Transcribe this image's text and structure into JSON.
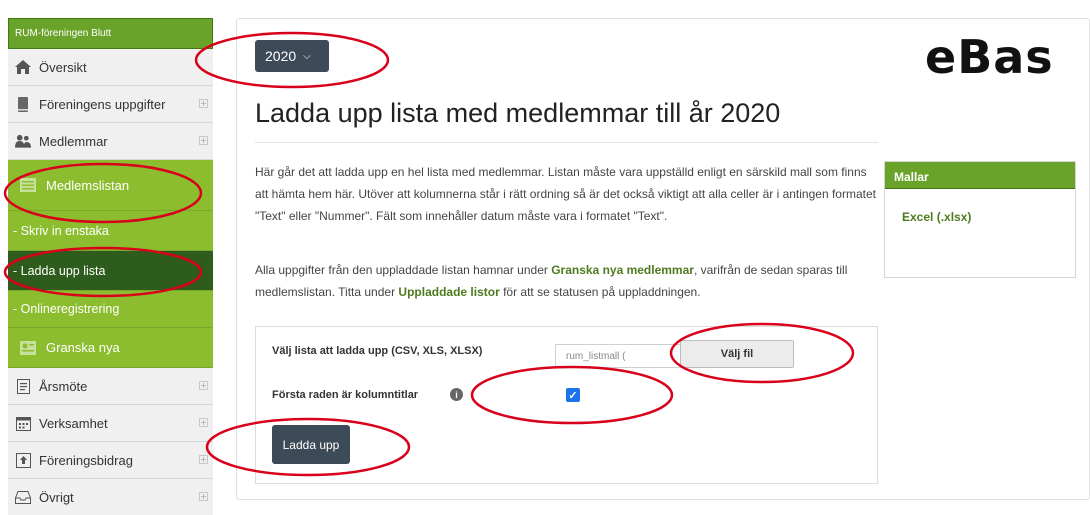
{
  "sidebar": {
    "org_name": "RUM-föreningen Blutt",
    "items": [
      {
        "label": "Översikt"
      },
      {
        "label": "Föreningens uppgifter"
      },
      {
        "label": "Medlemmar"
      },
      {
        "label": "Medlemslistan"
      },
      {
        "label": "- Skriv in enstaka"
      },
      {
        "label": "- Ladda upp lista"
      },
      {
        "label": "- Onlineregistrering"
      },
      {
        "label": "Granska nya"
      },
      {
        "label": "Årsmöte"
      },
      {
        "label": "Verksamhet"
      },
      {
        "label": "Föreningsbidrag"
      },
      {
        "label": "Övrigt"
      }
    ]
  },
  "header": {
    "year": "2020",
    "logo": "eBas",
    "title": "Ladda upp lista med medlemmar till år 2020"
  },
  "intro": {
    "p1": "Här går det att ladda upp en hel lista med medlemmar. Listan måste vara uppställd enligt en särskild mall som finns att hämta hem här. Utöver att kolumnerna står i rätt ordning så är det också viktigt att alla celler är i antingen formatet \"Text\" eller \"Nummer\". Fält som innehåller datum måste vara i formatet \"Text\".",
    "p2_a": "Alla uppgifter från den uppladdade listan hamnar under ",
    "p2_link1": "Granska nya medlemmar",
    "p2_b": ", varifrån de sedan sparas till medlemslistan. Titta under ",
    "p2_link2": "Uppladdade listor",
    "p2_c": " för att se statusen på uppladdningen."
  },
  "mallar": {
    "title": "Mallar",
    "link": "Excel (.xlsx)"
  },
  "form": {
    "file_label": "Välj lista att ladda upp (CSV, XLS, XLSX)",
    "file_name": "rum_listmall (",
    "choose_button": "Välj fil",
    "header_row_label": "Första raden är kolumntitlar",
    "header_row_checked": true,
    "upload_button": "Ladda upp"
  },
  "colors": {
    "green": "#8cbd2f",
    "dark_green": "#2e5c1c",
    "button_dark": "#3d4a57",
    "annotation_red": "#d9001b"
  }
}
